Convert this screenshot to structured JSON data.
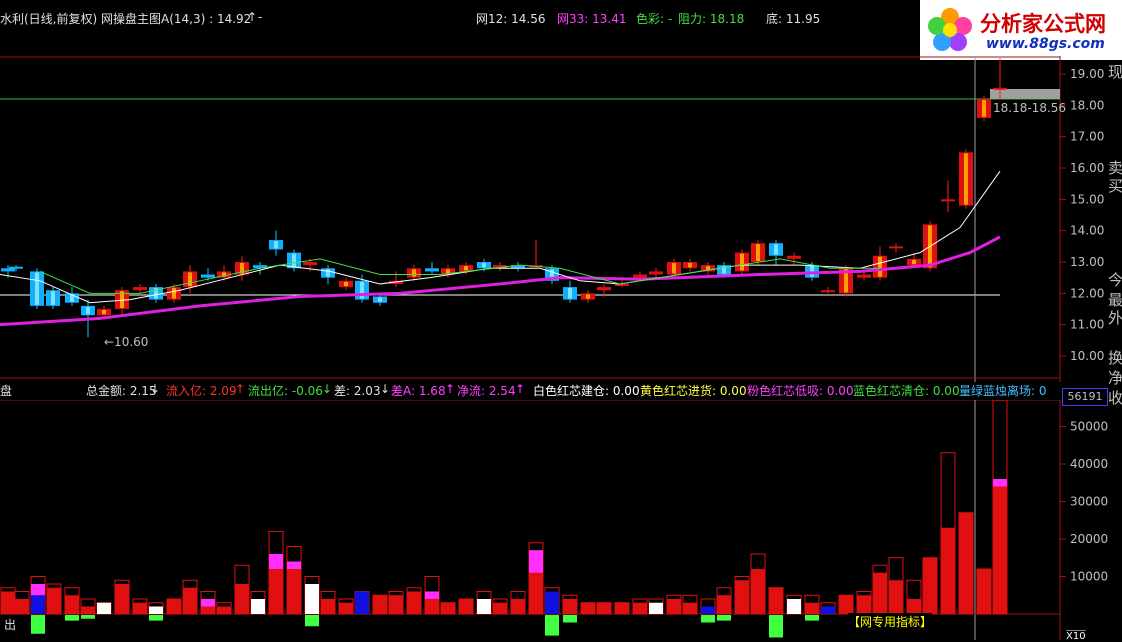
{
  "main": {
    "title": "水利(日线,前复权) 网操盘主图A(14,3) : 14.92",
    "title_suffix": "- ",
    "net12": "网12: 14.56",
    "net33": "网33: 13.41",
    "color_label": "色彩: -",
    "resistance": "阻力: 18.18",
    "bottom": "底: 11.95",
    "low_marker": "←10.60",
    "price_tag": "18.18-18.56",
    "price_axis": [
      "19.00",
      "18.00",
      "17.00",
      "16.00",
      "15.00",
      "14.00",
      "13.00",
      "12.00",
      "11.00",
      "10.00"
    ]
  },
  "indicator": {
    "name": "盘",
    "total": "总金额: 2.15",
    "inflow": "流入亿: 2.09",
    "outflow": "流出亿: -0.06",
    "diff": "差: 2.03",
    "diff_a": "差A: 1.68",
    "net": "净流: 2.54",
    "white": "白色红芯建仓: 0.00",
    "yellow": "黄色红芯进货: 0.00",
    "pink": "粉色红芯低吸: 0.00",
    "blue": "蓝色红芯清仓: 0.00",
    "green": "量绿蓝烛离场: 0",
    "box_value": "56191",
    "vol_axis": [
      "50000",
      "40000",
      "30000",
      "20000",
      "10000"
    ],
    "bottom_left": "出",
    "tag": "【网专用指标】",
    "x_label": "X10"
  },
  "logo": {
    "brand": "分析家公式网",
    "url": "www.88gs.com"
  },
  "right_panel": [
    "现",
    "卖",
    "买",
    "今",
    "最",
    "外",
    "换",
    "净",
    "收"
  ],
  "colors": {
    "up": "#ff2020",
    "down": "#00d0ff",
    "ma_pink": "#e020e0",
    "ma_white": "#ffffff",
    "ma_green": "#40e040",
    "resist_line": "#30c030"
  }
}
